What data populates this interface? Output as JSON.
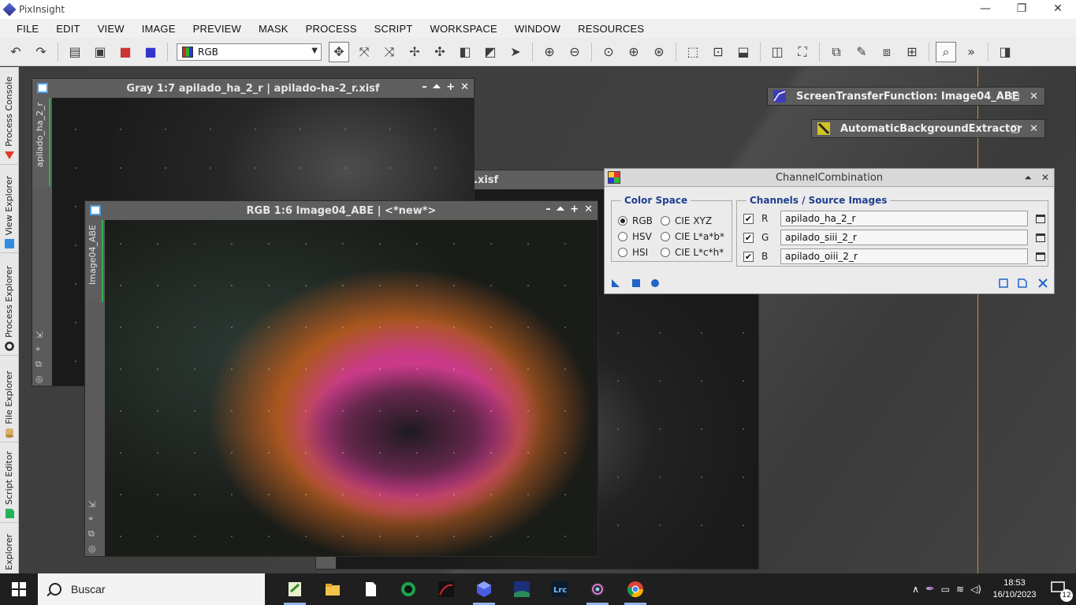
{
  "app": {
    "title": "PixInsight",
    "controls": [
      "—",
      "❐",
      "✕"
    ]
  },
  "menu": [
    "FILE",
    "EDIT",
    "VIEW",
    "IMAGE",
    "PREVIEW",
    "MASK",
    "PROCESS",
    "SCRIPT",
    "WORKSPACE",
    "WINDOW",
    "RESOURCES"
  ],
  "toolbar": {
    "channel_value": "RGB"
  },
  "side_tabs": [
    "Process Console",
    "View Explorer",
    "Process Explorer",
    "File Explorer",
    "Script Editor",
    "Explorer"
  ],
  "windows": {
    "gray": {
      "title": "Gray 1:7 apilado_ha_2_r | apilado-ha-2_r.xisf",
      "tab": "apilado_ha_2_r"
    },
    "partial": {
      "title": ".xisf"
    },
    "rgb": {
      "title": "RGB 1:6 Image04_ABE | <*new*>",
      "tab": "Image04_ABE"
    }
  },
  "tools": {
    "stf": "ScreenTransferFunction: Image04_ABE",
    "abe": "AutomaticBackgroundExtractor"
  },
  "channel_combination": {
    "title": "ChannelCombination",
    "color_space_label": "Color Space",
    "channels_label": "Channels / Source Images",
    "color_spaces": [
      {
        "label": "RGB",
        "selected": true
      },
      {
        "label": "CIE XYZ",
        "selected": false
      },
      {
        "label": "HSV",
        "selected": false
      },
      {
        "label": "CIE L*a*b*",
        "selected": false
      },
      {
        "label": "HSI",
        "selected": false
      },
      {
        "label": "CIE L*c*h*",
        "selected": false
      }
    ],
    "channels": [
      {
        "letter": "R",
        "checked": true,
        "source": "apilado_ha_2_r"
      },
      {
        "letter": "G",
        "checked": true,
        "source": "apilado_siii_2_r"
      },
      {
        "letter": "B",
        "checked": true,
        "source": "apilado_oiii_2_r"
      }
    ]
  },
  "taskbar": {
    "search_placeholder": "Buscar",
    "time": "18:53",
    "date": "16/10/2023",
    "notifications": "12"
  }
}
